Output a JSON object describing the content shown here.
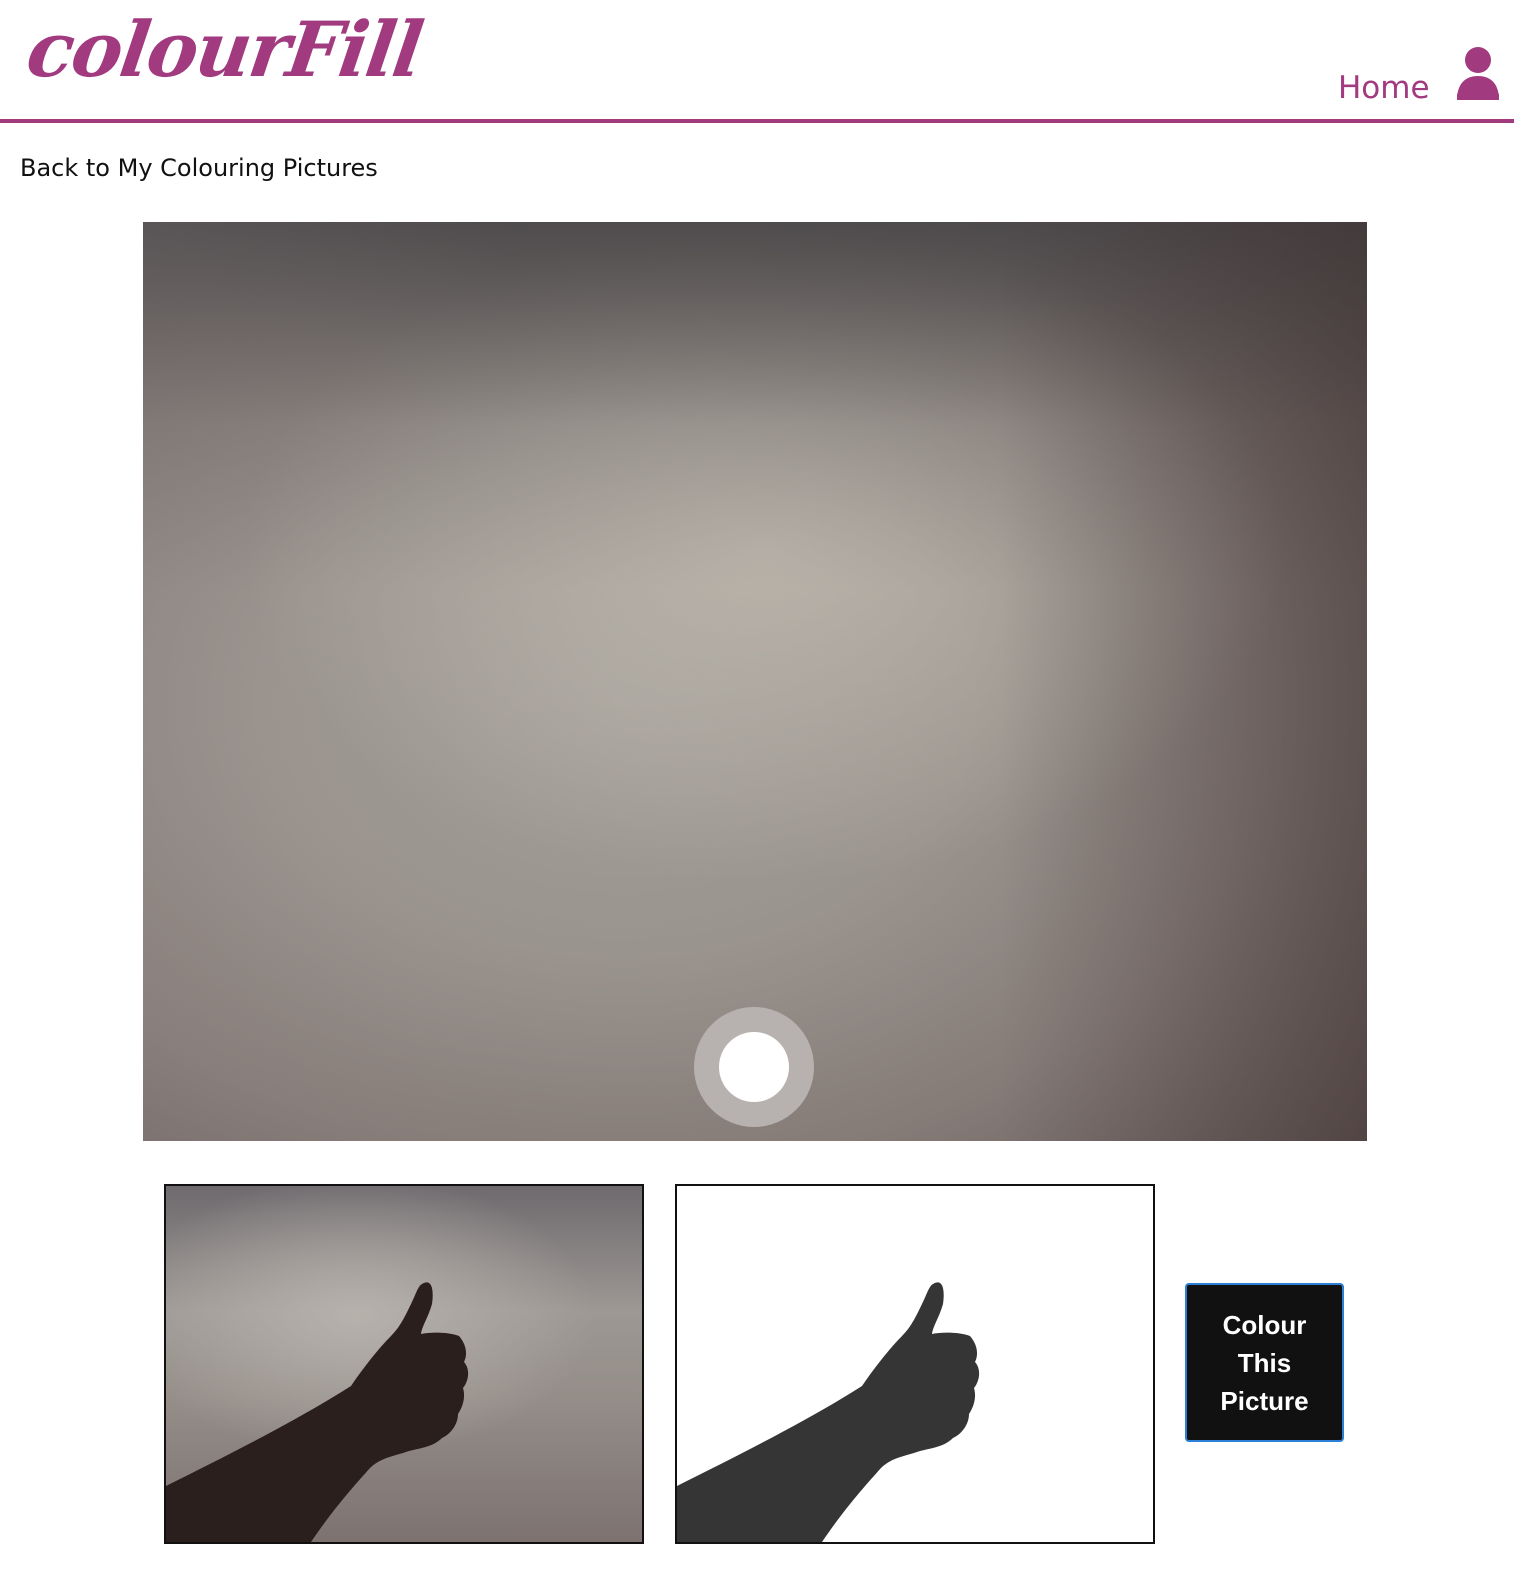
{
  "header": {
    "logo": "colourFill",
    "nav_home": "Home",
    "user_icon": "user-icon",
    "accent_color": "#a23a7f"
  },
  "page": {
    "back_link": "Back to My Colouring Pictures"
  },
  "camera": {
    "shutter_icon": "shutter-button-icon"
  },
  "preview": {
    "photo_alt": "captured-photo-thumbs-up",
    "outline_alt": "colouring-outline-thumbs-up"
  },
  "actions": {
    "colour_button": "Colour This Picture",
    "button_border_color": "#2b7fd4"
  }
}
